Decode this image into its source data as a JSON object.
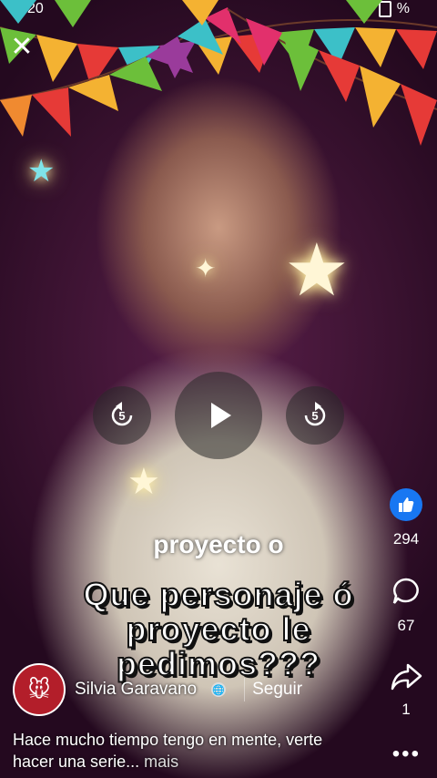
{
  "status_bar": {
    "time": "20",
    "battery_text": "%"
  },
  "video": {
    "rewind_seconds": "5",
    "forward_seconds": "5",
    "caption_small": "proyecto o",
    "caption_main": "Que personaje ó proyecto le pedimos???"
  },
  "actions": {
    "likes": "294",
    "comments": "67",
    "shares": "1"
  },
  "author": {
    "name": "Silvia Garavano",
    "follow_label": "Seguir"
  },
  "description": {
    "text": "Hace mucho tiempo tengo en mente, verte hacer una serie...",
    "more_label": "mais"
  },
  "colors": {
    "like_blue": "#1877f2"
  }
}
